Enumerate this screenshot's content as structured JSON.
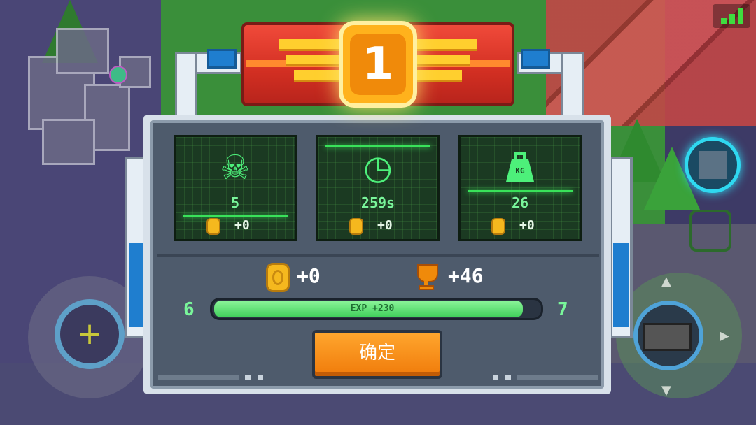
{
  "rank": {
    "number": "1"
  },
  "stats": [
    {
      "icon": "skull-icon",
      "glyph": "☠",
      "value": "5",
      "coin_bonus": "+0"
    },
    {
      "icon": "clock-icon",
      "glyph": "◷",
      "value": "259s",
      "coin_bonus": "+0"
    },
    {
      "icon": "weight-icon",
      "glyph": "⏏",
      "value": "26",
      "coin_bonus": "+0"
    }
  ],
  "weight_label": "KG",
  "rewards": {
    "coins": "+0",
    "trophies": "+46"
  },
  "experience": {
    "current_level": "6",
    "next_level": "7",
    "label": "EXP +230",
    "fill_fraction": 0.95
  },
  "confirm_label": "确定",
  "colors": {
    "accent_green": "#79f59a",
    "button_orange": "#f07b0a",
    "banner_red": "#d22f22",
    "medal_gold": "#ffb21c"
  }
}
